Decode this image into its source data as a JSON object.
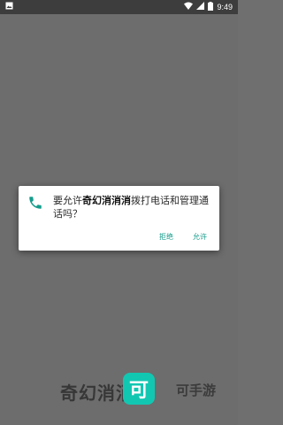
{
  "status_bar": {
    "time": "9:49",
    "icons": [
      "image-icon",
      "wifi-icon",
      "signal-icon",
      "battery-icon"
    ]
  },
  "dialog": {
    "icon": "phone-icon",
    "message_prefix": "要允许",
    "app_name": "奇幻消消消",
    "message_suffix": "拨打电话和管理通话吗？",
    "deny_label": "拒绝",
    "allow_label": "允许",
    "accent_color": "#159c8b"
  },
  "watermark": {
    "left_text": "奇幻消消消",
    "logo_char": "可",
    "right_text": "可手游"
  }
}
